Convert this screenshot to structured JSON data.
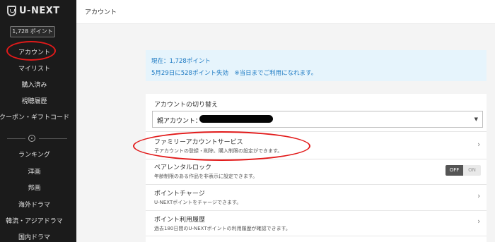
{
  "app": {
    "logo_text": "U-NEXT"
  },
  "sidebar": {
    "points_badge": "1,728 ポイント",
    "items": [
      {
        "label": "アカウント"
      },
      {
        "label": "マイリスト"
      },
      {
        "label": "購入済み"
      },
      {
        "label": "視聴履歴"
      },
      {
        "label": "クーポン・ギフトコード"
      }
    ],
    "genres": [
      {
        "label": "ランキング"
      },
      {
        "label": "洋画"
      },
      {
        "label": "邦画"
      },
      {
        "label": "海外ドラマ"
      },
      {
        "label": "韓流・アジアドラマ"
      },
      {
        "label": "国内ドラマ"
      }
    ]
  },
  "header": {
    "title": "アカウント"
  },
  "info": {
    "current_points": "現在：1,728ポイント",
    "expiry": "5月29日に528ポイント失効　※当日までご利用になれます。"
  },
  "account_switch": {
    "title": "アカウントの切り替え",
    "selected": "親アカウント："
  },
  "rows": [
    {
      "title": "ファミリーアカウントサービス",
      "subtitle": "子アカウントの登録・削除、購入制限の設定ができます。"
    },
    {
      "title": "ペアレンタルロック",
      "subtitle": "年齢制限のある作品を非表示に設定できます。"
    },
    {
      "title": "ポイントチャージ",
      "subtitle": "U-NEXTポイントをチャージできます。"
    },
    {
      "title": "ポイント利用履歴",
      "subtitle": "過去180日間のU-NEXTポイントの利用履歴が確認できます。"
    }
  ],
  "toggle": {
    "off_label": "OFF",
    "on_label": "ON",
    "state": "OFF"
  },
  "colors": {
    "sidebar_bg": "#1b1b1b",
    "info_text": "#1a78c2",
    "info_bg": "#e6f4fc",
    "annotation": "#e21a1a"
  }
}
